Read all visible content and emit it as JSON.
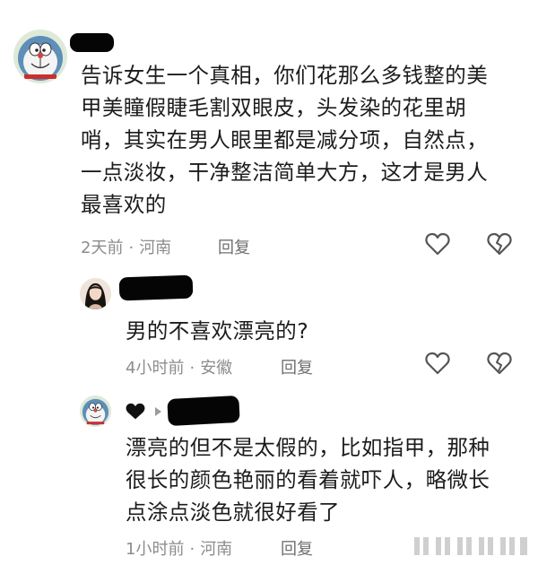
{
  "comments": [
    {
      "text": "告诉女生一个真相，你们花那么多钱整的美甲美瞳假睫毛割双眼皮，头发染的花里胡哨，其实在男人眼里都是减分项，自然点，一点淡妆，干净整洁简单大方，这才是男人最喜欢的",
      "time": "2天前",
      "location": "河南",
      "reply_label": "回复"
    },
    {
      "text": "男的不喜欢漂亮的?",
      "time": "4小时前",
      "location": "安徽",
      "reply_label": "回复"
    },
    {
      "text": "漂亮的但不是太假的，比如指甲，那种很长的颜色艳丽的看着就吓人，略微长点涂点淡色就很好看了",
      "time": "1小时前",
      "location": "河南",
      "reply_label": "回复"
    }
  ],
  "meta_separator": "·",
  "icons": {
    "like": "heart-outline-icon",
    "dislike": "broken-heart-icon",
    "reply_to": "reply-arrow-icon"
  },
  "colors": {
    "text": "#1c1c1c",
    "meta": "#8c8c8c",
    "icon": "#555555"
  }
}
